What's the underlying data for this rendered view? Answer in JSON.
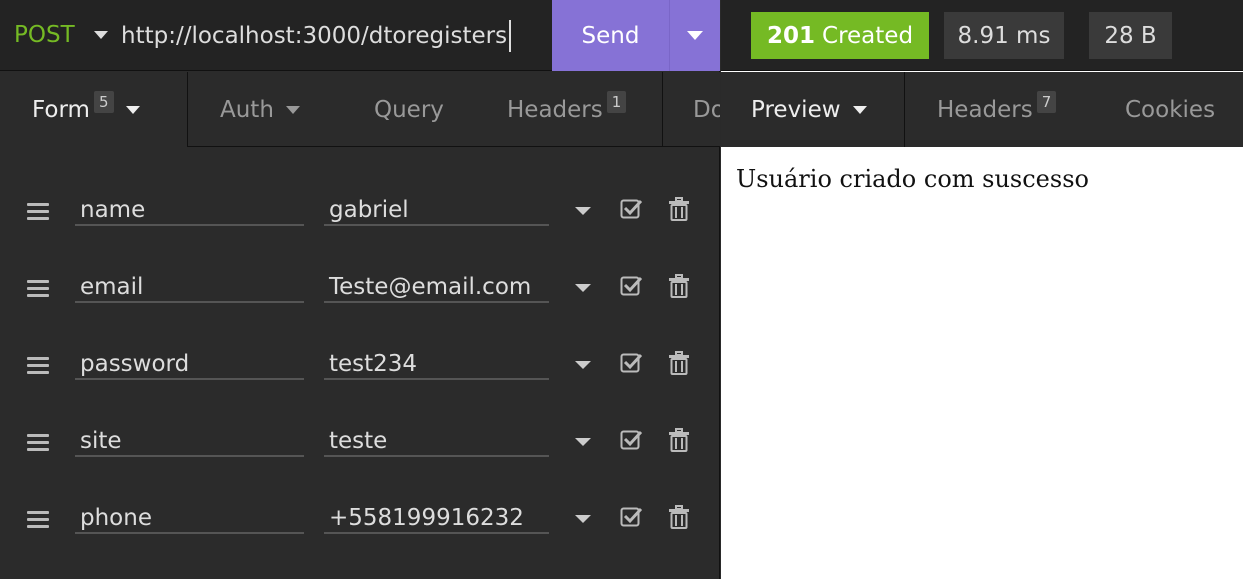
{
  "request": {
    "method": "POST",
    "url": "http://localhost:3000/dtoregisters",
    "send_label": "Send"
  },
  "request_tabs": [
    {
      "label": "Form",
      "badge": "5",
      "active": true
    },
    {
      "label": "Auth",
      "badge": "",
      "active": false
    },
    {
      "label": "Query",
      "badge": "",
      "active": false
    },
    {
      "label": "Headers",
      "badge": "1",
      "active": false
    },
    {
      "label": "Do",
      "badge": "",
      "active": false
    }
  ],
  "form_rows": [
    {
      "key": "name",
      "value": "gabriel"
    },
    {
      "key": "email",
      "value": "Teste@email.com"
    },
    {
      "key": "password",
      "value": "test234"
    },
    {
      "key": "site",
      "value": "teste"
    },
    {
      "key": "phone",
      "value": "+558199916232"
    }
  ],
  "response": {
    "status_code": "201",
    "status_text": "Created",
    "time": "8.91 ms",
    "size": "28 B",
    "status_color": "#75ba24"
  },
  "response_tabs": [
    {
      "label": "Preview",
      "badge": "",
      "active": true
    },
    {
      "label": "Headers",
      "badge": "7",
      "active": false
    },
    {
      "label": "Cookies",
      "badge": "",
      "active": false
    }
  ],
  "preview": {
    "text": "Usuário criado com suscesso"
  },
  "colors": {
    "accent": "#8672d6",
    "method": "#75ba24"
  }
}
